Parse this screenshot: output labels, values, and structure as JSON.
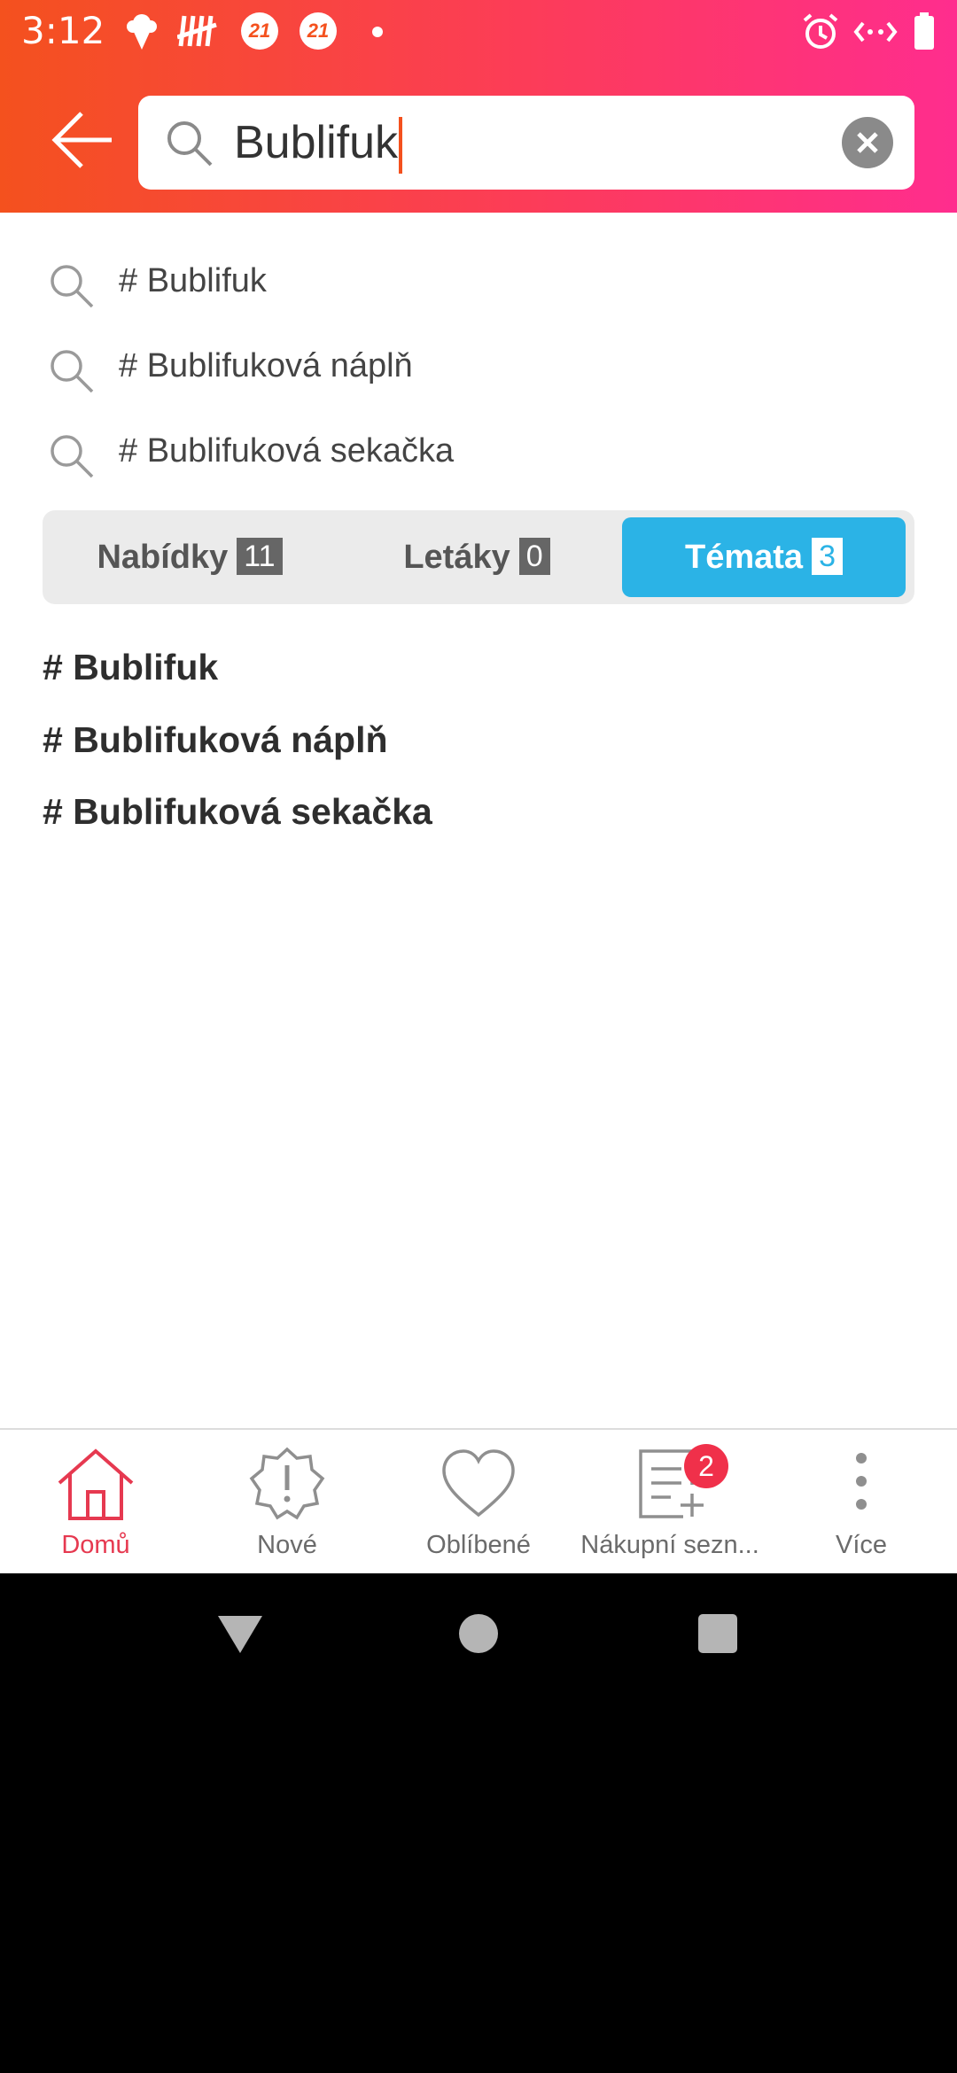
{
  "status_bar": {
    "time": "3:12",
    "notification_badges": [
      "21",
      "21"
    ]
  },
  "search": {
    "query": "Bublifuk"
  },
  "suggestions": [
    {
      "text": "# Bublifuk"
    },
    {
      "text": "# Bublifuková náplň"
    },
    {
      "text": "# Bublifuková sekačka"
    }
  ],
  "tabs": [
    {
      "label": "Nabídky",
      "count": "11",
      "active": false
    },
    {
      "label": "Letáky",
      "count": "0",
      "active": false
    },
    {
      "label": "Témata",
      "count": "3",
      "active": true
    }
  ],
  "results": [
    {
      "text": "# Bublifuk"
    },
    {
      "text": "# Bublifuková náplň"
    },
    {
      "text": "# Bublifuková sekačka"
    }
  ],
  "bottom_nav": {
    "items": [
      {
        "label": "Domů",
        "icon": "home-icon",
        "active": true
      },
      {
        "label": "Nové",
        "icon": "new-badge-icon",
        "active": false
      },
      {
        "label": "Oblíbené",
        "icon": "heart-icon",
        "active": false
      },
      {
        "label": "Nákupní sezn...",
        "icon": "shopping-list-icon",
        "active": false,
        "badge": "2"
      },
      {
        "label": "Více",
        "icon": "more-vertical-icon",
        "active": false
      }
    ]
  },
  "colors": {
    "header_gradient_start": "#f4511e",
    "header_gradient_end": "#ff2d8e",
    "accent_active_tab": "#2bb3e6",
    "nav_active": "#e63950",
    "badge": "#f0304a"
  }
}
